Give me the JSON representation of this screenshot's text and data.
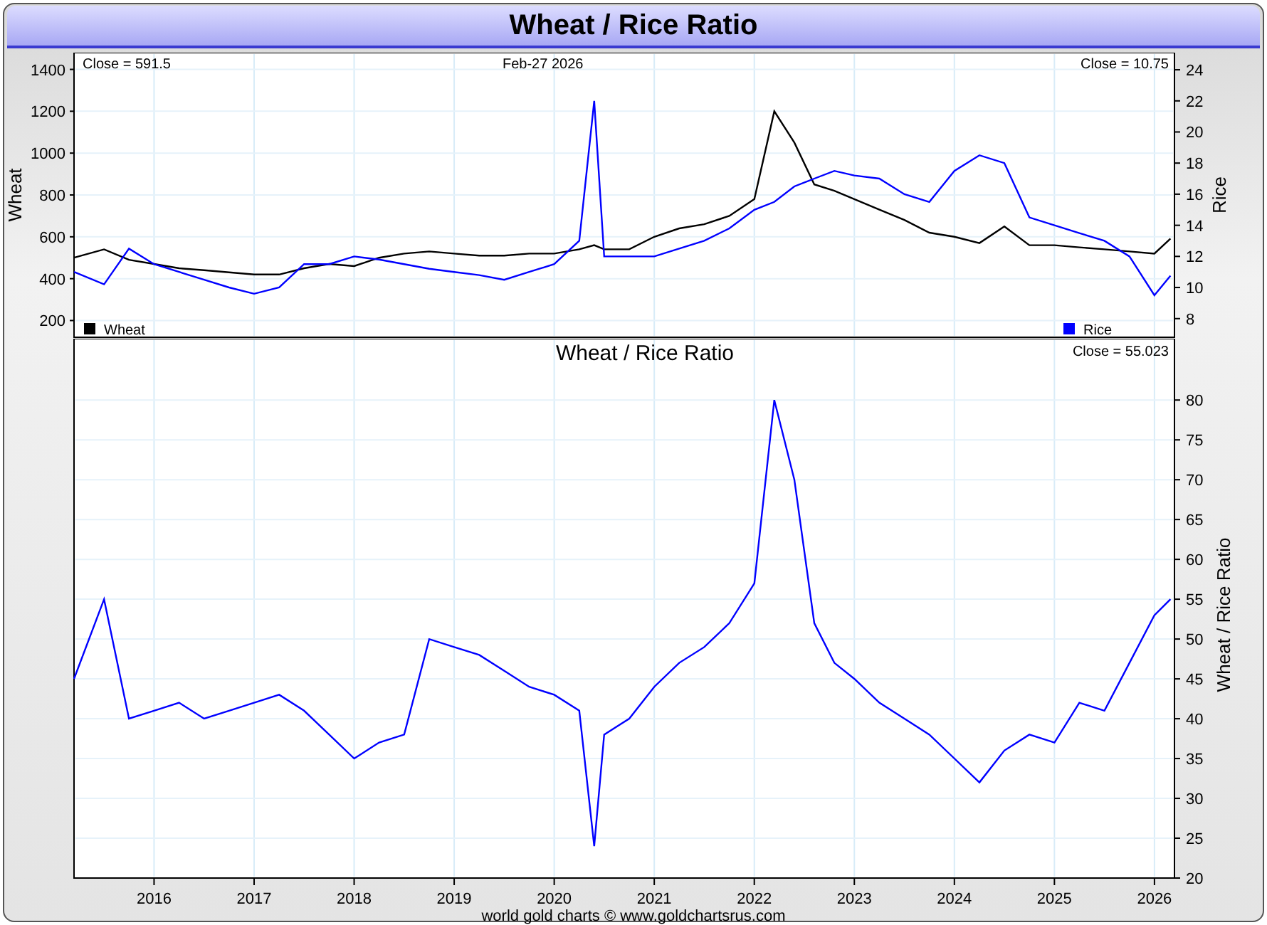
{
  "title": "Wheat / Rice Ratio",
  "top_panel": {
    "close_left": "Close = 591.5",
    "date": "Feb-27  2026",
    "close_right": "Close = 10.75",
    "wheat_chart": {
      "chart_data": {
        "type": "line",
        "ylabel": "Wheat",
        "x": [
          2015.2,
          2015.5,
          2015.75,
          2016,
          2016.25,
          2016.5,
          2016.75,
          2017,
          2017.25,
          2017.5,
          2017.75,
          2018,
          2018.25,
          2018.5,
          2018.75,
          2019,
          2019.25,
          2019.5,
          2019.75,
          2020,
          2020.25,
          2020.4,
          2020.5,
          2020.75,
          2021,
          2021.25,
          2021.5,
          2021.75,
          2022,
          2022.2,
          2022.4,
          2022.6,
          2022.8,
          2023,
          2023.25,
          2023.5,
          2023.75,
          2024,
          2024.25,
          2024.5,
          2024.75,
          2025,
          2025.25,
          2025.5,
          2025.75,
          2026,
          2026.16
        ],
        "series": [
          {
            "name": "Wheat",
            "color": "#000000",
            "values": [
              500,
              540,
              490,
              470,
              450,
              440,
              430,
              420,
              420,
              450,
              470,
              460,
              500,
              520,
              530,
              520,
              510,
              510,
              520,
              520,
              540,
              560,
              540,
              540,
              600,
              640,
              660,
              700,
              780,
              1200,
              1050,
              850,
              820,
              780,
              730,
              680,
              620,
              600,
              570,
              650,
              560,
              560,
              550,
              540,
              530,
              520,
              591.5
            ]
          }
        ],
        "xlim": [
          2015.2,
          2026.2
        ],
        "ylim": [
          120,
          1480
        ],
        "grid": true,
        "yticks": [
          200,
          400,
          600,
          800,
          1000,
          1200,
          1400
        ]
      }
    },
    "rice_chart": {
      "chart_data": {
        "type": "line",
        "ylabel": "Rice",
        "x": [
          2015.2,
          2015.5,
          2015.75,
          2016,
          2016.25,
          2016.5,
          2016.75,
          2017,
          2017.25,
          2017.5,
          2017.75,
          2018,
          2018.25,
          2018.5,
          2018.75,
          2019,
          2019.25,
          2019.5,
          2019.75,
          2020,
          2020.25,
          2020.4,
          2020.5,
          2020.75,
          2021,
          2021.25,
          2021.5,
          2021.75,
          2022,
          2022.2,
          2022.4,
          2022.6,
          2022.8,
          2023,
          2023.25,
          2023.5,
          2023.75,
          2024,
          2024.25,
          2024.5,
          2024.75,
          2025,
          2025.25,
          2025.5,
          2025.75,
          2026,
          2026.16
        ],
        "series": [
          {
            "name": "Rice",
            "color": "#0000ff",
            "values": [
              11,
              10.2,
              12.5,
              11.5,
              11,
              10.5,
              10,
              9.6,
              10,
              11.5,
              11.5,
              12,
              11.8,
              11.5,
              11.2,
              11,
              10.8,
              10.5,
              11,
              11.5,
              13,
              22,
              12,
              12,
              12,
              12.5,
              13,
              13.8,
              15,
              15.5,
              16.5,
              17,
              17.5,
              17.2,
              17,
              16,
              15.5,
              17.5,
              18.5,
              18,
              14.5,
              14,
              13.5,
              13,
              12,
              9.5,
              10.75
            ]
          }
        ],
        "xlim": [
          2015.2,
          2026.2
        ],
        "ylim": [
          6.8,
          25.1
        ],
        "yticks": [
          8,
          10,
          12,
          14,
          16,
          18,
          20,
          22,
          24
        ]
      }
    }
  },
  "bottom_panel": {
    "close": "Close = 55.023",
    "chart_data": {
      "type": "line",
      "title": "Wheat  /  Rice Ratio",
      "ylabel": "Wheat / Rice Ratio",
      "x": [
        2015.2,
        2015.5,
        2015.75,
        2016,
        2016.25,
        2016.5,
        2016.75,
        2017,
        2017.25,
        2017.5,
        2017.75,
        2018,
        2018.25,
        2018.5,
        2018.75,
        2019,
        2019.25,
        2019.5,
        2019.75,
        2020,
        2020.25,
        2020.4,
        2020.5,
        2020.75,
        2021,
        2021.25,
        2021.5,
        2021.75,
        2022,
        2022.2,
        2022.4,
        2022.6,
        2022.8,
        2023,
        2023.25,
        2023.5,
        2023.75,
        2024,
        2024.25,
        2024.5,
        2024.75,
        2025,
        2025.25,
        2025.5,
        2025.75,
        2026,
        2026.16
      ],
      "series": [
        {
          "color": "#0000ff",
          "values": [
            45,
            55,
            40,
            41,
            42,
            40,
            41,
            42,
            43,
            41,
            38,
            35,
            37,
            38,
            50,
            49,
            48,
            46,
            44,
            43,
            41,
            24,
            38,
            40,
            44,
            47,
            49,
            52,
            57,
            80,
            70,
            52,
            47,
            45,
            42,
            40,
            38,
            35,
            32,
            36,
            38,
            37,
            42,
            41,
            47,
            53,
            55
          ]
        }
      ],
      "xlim": [
        2015.2,
        2026.2
      ],
      "ylim": [
        20,
        87.7
      ],
      "grid": true,
      "xticks": [
        {
          "value": 2016,
          "label": "2016"
        },
        {
          "value": 2017,
          "label": "2017"
        },
        {
          "value": 2018,
          "label": "2018"
        },
        {
          "value": 2019,
          "label": "2019"
        },
        {
          "value": 2020,
          "label": "2020"
        },
        {
          "value": 2021,
          "label": "2021"
        },
        {
          "value": 2022,
          "label": "2022"
        },
        {
          "value": 2023,
          "label": "2023"
        },
        {
          "value": 2024,
          "label": "2024"
        },
        {
          "value": 2025,
          "label": "2025"
        },
        {
          "value": 2026,
          "label": "2026"
        }
      ],
      "yticks": [
        20,
        25,
        30,
        35,
        40,
        45,
        50,
        55,
        60,
        65,
        70,
        75,
        80
      ]
    }
  },
  "footer": "world gold charts © www.goldchartsrus.com"
}
